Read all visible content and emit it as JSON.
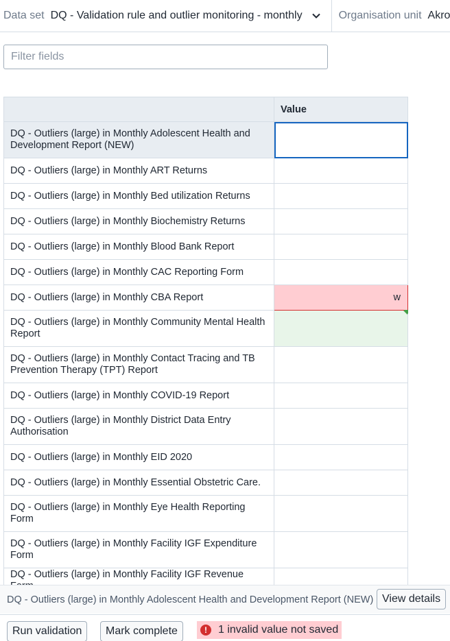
{
  "context": {
    "dataset_label": "Data set",
    "dataset_value": "DQ - Validation rule and outlier monitoring - monthly",
    "orgunit_label": "Organisation unit",
    "orgunit_value": "Akrod"
  },
  "filter": {
    "placeholder": "Filter fields",
    "value": ""
  },
  "table": {
    "headers": [
      "",
      "Value"
    ],
    "rows": [
      {
        "name": "DQ - Outliers (large) in Monthly Adolescent Health and Development Report (NEW)",
        "value": "",
        "state": "active"
      },
      {
        "name": "DQ - Outliers (large) in Monthly ART Returns",
        "value": "",
        "state": ""
      },
      {
        "name": "DQ - Outliers (large) in Monthly Bed utilization Returns",
        "value": "",
        "state": ""
      },
      {
        "name": "DQ - Outliers (large) in Monthly Biochemistry Returns",
        "value": "",
        "state": ""
      },
      {
        "name": "DQ - Outliers (large) in Monthly Blood Bank Report",
        "value": "",
        "state": ""
      },
      {
        "name": "DQ - Outliers (large) in Monthly CAC Reporting Form",
        "value": "",
        "state": ""
      },
      {
        "name": "DQ - Outliers (large) in Monthly CBA Report",
        "value": "w",
        "state": "invalid"
      },
      {
        "name": "DQ - Outliers (large) in Monthly Community Mental Health Report",
        "value": "",
        "state": "synced"
      },
      {
        "name": "DQ - Outliers (large) in Monthly Contact Tracing and TB Prevention Therapy (TPT) Report",
        "value": "",
        "state": ""
      },
      {
        "name": "DQ - Outliers (large) in Monthly COVID-19 Report",
        "value": "",
        "state": ""
      },
      {
        "name": "DQ - Outliers (large) in Monthly District Data Entry Authorisation",
        "value": "",
        "state": ""
      },
      {
        "name": "DQ - Outliers (large) in Monthly EID 2020",
        "value": "",
        "state": ""
      },
      {
        "name": "DQ - Outliers (large) in Monthly Essential Obstetric Care.",
        "value": "",
        "state": ""
      },
      {
        "name": "DQ - Outliers (large) in Monthly Eye Health Reporting Form",
        "value": "",
        "state": ""
      },
      {
        "name": "DQ - Outliers (large) in Monthly Facility IGF Expenditure Form",
        "value": "",
        "state": ""
      },
      {
        "name": "DQ - Outliers (large) in Monthly Facility IGF Revenue Form",
        "value": "",
        "state": ""
      }
    ]
  },
  "details": {
    "text": "DQ - Outliers (large) in Monthly Adolescent Health and Development Report (NEW)",
    "view_details_label": "View details"
  },
  "actions": {
    "run_validation_label": "Run validation",
    "mark_complete_label": "Mark complete",
    "error_icon": "!",
    "error_text": "1 invalid value not saved"
  },
  "colors": {
    "active_outline": "#1565c0",
    "invalid_bg": "#ffcdd2",
    "synced_bg": "#e8f5e9",
    "header_bg": "#e8edf2"
  }
}
